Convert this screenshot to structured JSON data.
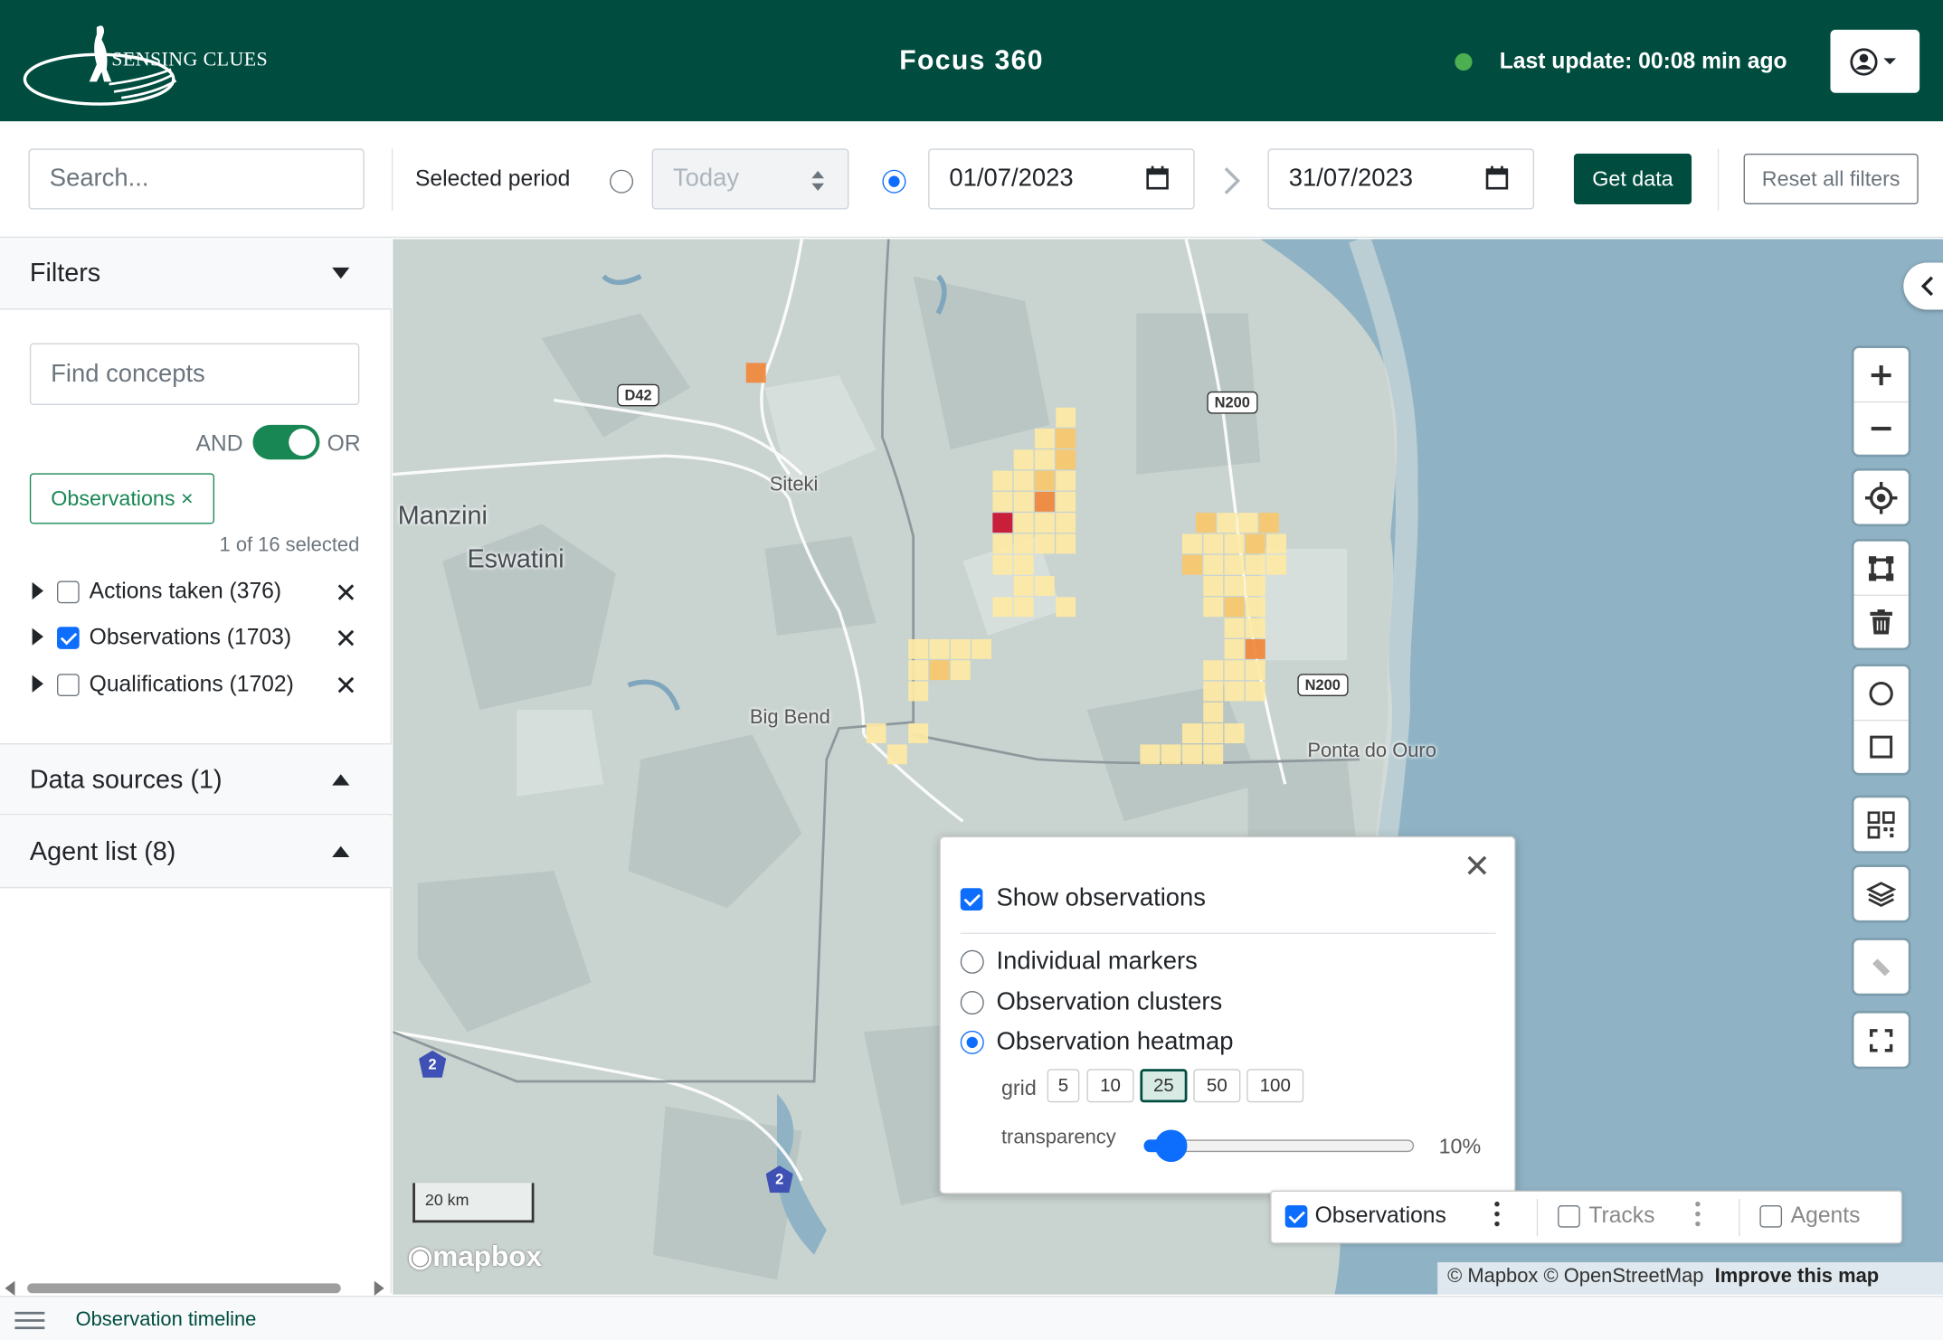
{
  "header": {
    "logo_text": "SENSING CLUES",
    "app_title": "Focus 360",
    "last_update": "Last update: 00:08 min ago",
    "status_color": "#4caf50"
  },
  "toolbar": {
    "search_placeholder": "Search...",
    "period_label": "Selected period",
    "today_option": "Today",
    "date_from": "01/07/2023",
    "date_to": "31/07/2023",
    "get_data": "Get data",
    "reset": "Reset all filters"
  },
  "sidebar": {
    "filters_title": "Filters",
    "find_placeholder": "Find concepts",
    "and_label": "AND",
    "or_label": "OR",
    "chip": "Observations ×",
    "selected_count": "1 of 16 selected",
    "tree": [
      {
        "label": "Actions taken (376)",
        "checked": false
      },
      {
        "label": "Observations (1703)",
        "checked": true
      },
      {
        "label": "Qualifications (1702)",
        "checked": false
      }
    ],
    "data_sources": "Data sources (1)",
    "agent_list": "Agent list (8)"
  },
  "map": {
    "labels": {
      "manzini": "Manzini",
      "eswatini": "Eswatini",
      "siteki": "Siteki",
      "big_bend": "Big Bend",
      "ponta": "Ponta do Ouro"
    },
    "road_shields": {
      "d42": "D42",
      "n200a": "N200",
      "n200b": "N200"
    },
    "route_badges": {
      "a": "2",
      "b": "2"
    },
    "scale": "20 km",
    "mapbox": "mapbox",
    "attribution": "© Mapbox © OpenStreetMap",
    "improve": "Improve this map",
    "colors": {
      "land": "#c9d3d0",
      "water": "#8fb3c5",
      "heat_low": "#fde9a4",
      "heat_mid": "#f9c86a",
      "heat_high": "#f0873a",
      "heat_max": "#c8102e"
    }
  },
  "popup": {
    "show_label": "Show observations",
    "show_checked": true,
    "options": [
      {
        "label": "Individual markers",
        "selected": false
      },
      {
        "label": "Observation clusters",
        "selected": false
      },
      {
        "label": "Observation heatmap",
        "selected": true
      }
    ],
    "grid_label": "grid",
    "grid_values": [
      "5",
      "10",
      "25",
      "50",
      "100"
    ],
    "grid_selected": "25",
    "transparency_label": "transparency",
    "transparency_value": "10%"
  },
  "layers": {
    "observations": "Observations",
    "tracks": "Tracks",
    "agents": "Agents"
  },
  "bottom": {
    "timeline": "Observation timeline"
  }
}
